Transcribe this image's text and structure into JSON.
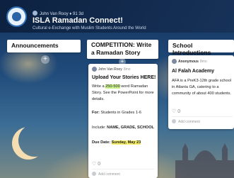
{
  "header": {
    "author": "John Van Rooy",
    "likes": "♦ 91",
    "age": "3d",
    "title": "ISLA Ramadan Connect!",
    "subtitle": "Cultural e-Exchange with Muslim Students Around the World"
  },
  "columns": [
    {
      "title": "Announcements",
      "add_label": "+"
    },
    {
      "title": "COMPETITION: Write a Ramadan Story",
      "add_label": "+"
    },
    {
      "title": "School Introductions",
      "add_label": "+"
    }
  ],
  "cards": {
    "competition": {
      "author": "John Van Rooy",
      "time": "8mo",
      "title": "Upload Your Stories HERE!",
      "body_pre": "Write a ",
      "body_hl": "250-500",
      "body_post": " word Ramadan Story. See the PowerPoint for more details.",
      "for_label": "For:",
      "for_text": " Students in Grades 1-6",
      "include_label": "Include: ",
      "include_text": "NAME, GRADE, SCHOOL",
      "due_label": "Due Date: ",
      "due_text": "Sunday, May 23",
      "likes": "0",
      "add_comment": "Add comment"
    },
    "intro": {
      "author": "Anonymous",
      "time": "8mo",
      "title": "Al Falah Academy",
      "body": "AFA is a PreK3-12th grade school in Atlanta GA, catering to a community of about 400 students.",
      "likes": "0",
      "add_comment": "Add comment"
    }
  },
  "colors": {
    "header_bg": "#0c203e",
    "accent": "#2a63a6",
    "highlight_green": "#c9f28a",
    "highlight_yellow": "#f7ee6b"
  }
}
